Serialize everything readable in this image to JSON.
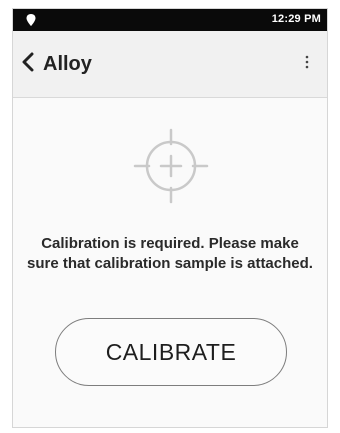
{
  "status_bar": {
    "time": "12:29 PM",
    "location_icon": "location-pin-icon"
  },
  "app_bar": {
    "title": "Alloy",
    "back_icon": "chevron-left-icon",
    "menu_icon": "more-vertical-icon"
  },
  "main": {
    "target_icon": "crosshair-target-icon",
    "message": "Calibration is required. Please make sure that calibration sample is attached.",
    "calibrate_label": "CALIBRATE"
  },
  "colors": {
    "status_bar_bg": "#0a0a0a",
    "app_bar_bg": "#f1f1f1",
    "content_bg": "#fafafa",
    "icon_gray": "#c9c9c9",
    "button_border": "#7d7d7d"
  }
}
